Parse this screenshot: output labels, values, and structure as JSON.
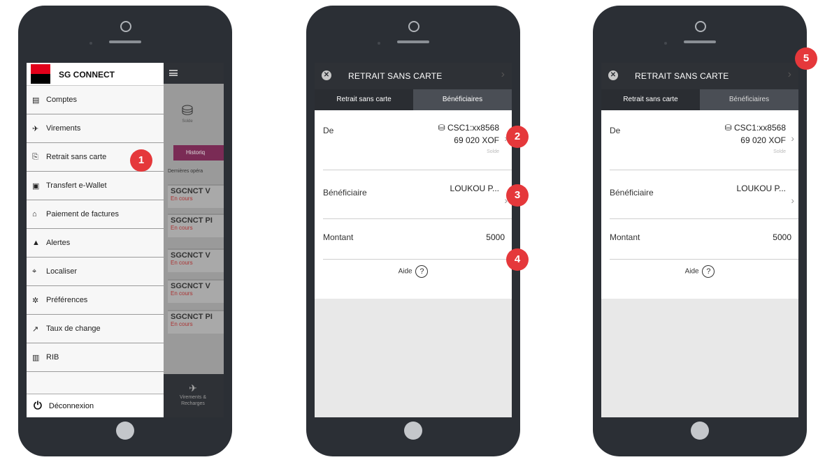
{
  "phone1": {
    "brand": "SG CONNECT",
    "menu_items": [
      {
        "icon": "accounts-icon",
        "glyph": "▤",
        "label": "Comptes"
      },
      {
        "icon": "transfer-icon",
        "glyph": "✈",
        "label": "Virements"
      },
      {
        "icon": "cardless-withdrawal-icon",
        "glyph": "⎘",
        "label": "Retrait sans carte"
      },
      {
        "icon": "wallet-icon",
        "glyph": "▣",
        "label": "Transfert e-Wallet"
      },
      {
        "icon": "bill-payment-icon",
        "glyph": "⌂",
        "label": "Paiement de factures"
      },
      {
        "icon": "bell-icon",
        "glyph": "▲",
        "label": "Alertes"
      },
      {
        "icon": "locate-icon",
        "glyph": "⌖",
        "label": "Localiser"
      },
      {
        "icon": "gear-icon",
        "glyph": "✲",
        "label": "Préférences"
      },
      {
        "icon": "exchange-rate-icon",
        "glyph": "↗",
        "label": "Taux de change"
      },
      {
        "icon": "rib-icon",
        "glyph": "▥",
        "label": "RIB"
      }
    ],
    "logout_label": "Déconnexion",
    "background": {
      "solde_label": "Solde",
      "historique_label": "Historiq",
      "last_ops_label": "Dernières opéra",
      "operations": [
        {
          "title": "SGCNCT V",
          "status": "En cours"
        },
        {
          "title": "SGCNCT PI",
          "status": "En cours"
        },
        {
          "title": "SGCNCT V",
          "status": "En cours"
        },
        {
          "title": "SGCNCT V",
          "status": "En cours"
        },
        {
          "title": "SGCNCT PI",
          "status": "En cours"
        }
      ],
      "bottom_label_1": "Virements &",
      "bottom_label_2": "Recharges"
    }
  },
  "screen": {
    "title": "RETRAIT SANS CARTE",
    "tab_active": "Retrait sans carte",
    "tab_inactive": "Bénéficiaires",
    "de_label": "De",
    "account": "CSC1:xx8568",
    "amount_balance": "69 020 XOF",
    "solde_label": "Solde",
    "beneficiaire_label": "Bénéficiaire",
    "beneficiaire_value": "LOUKOU P...",
    "montant_label": "Montant",
    "montant_value": "5000",
    "aide_label": "Aide",
    "aide_icon": "?"
  },
  "badges": {
    "b1": "1",
    "b2": "2",
    "b3": "3",
    "b4": "4",
    "b5": "5"
  },
  "colors": {
    "accent": "#e5383b",
    "brand_red": "#e2001a",
    "dark": "#2e3136"
  }
}
